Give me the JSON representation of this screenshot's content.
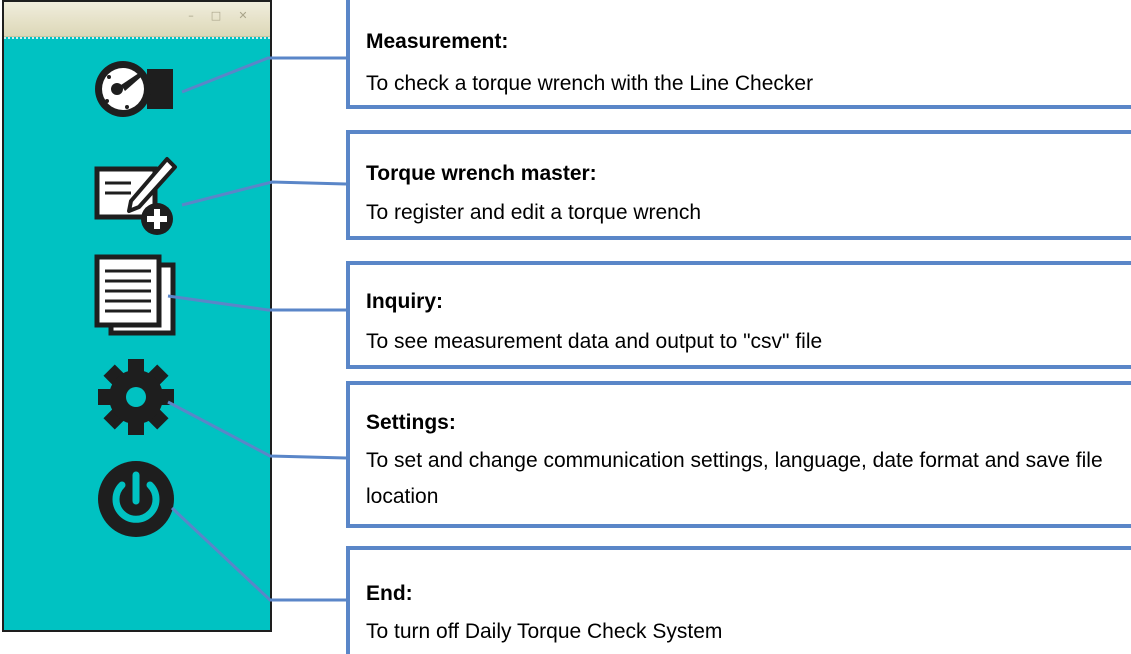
{
  "window": {
    "titlebar_buttons": [
      "–",
      "□",
      "✕"
    ],
    "background_color": "#00c2c2",
    "icon_color": "#1e1e1e"
  },
  "menu": [
    {
      "id": "measurement",
      "icon": "torque-checker-icon"
    },
    {
      "id": "torque-wrench-master",
      "icon": "edit-add-icon"
    },
    {
      "id": "inquiry",
      "icon": "documents-icon"
    },
    {
      "id": "settings",
      "icon": "gear-icon"
    },
    {
      "id": "end",
      "icon": "power-icon"
    }
  ],
  "callouts": [
    {
      "title": "Measurement:",
      "description": "To check a torque wrench with the Line Checker"
    },
    {
      "title": "Torque wrench master:",
      "description": "To register and edit a torque wrench"
    },
    {
      "title": "Inquiry:",
      "description": "To see measurement data and output to \"csv\" file"
    },
    {
      "title": "Settings:",
      "description": "To set and change communication settings, language, date format and save file location"
    },
    {
      "title": "End:",
      "description": "To turn off Daily Torque Check System"
    }
  ],
  "accent_color": "#5a86c8"
}
